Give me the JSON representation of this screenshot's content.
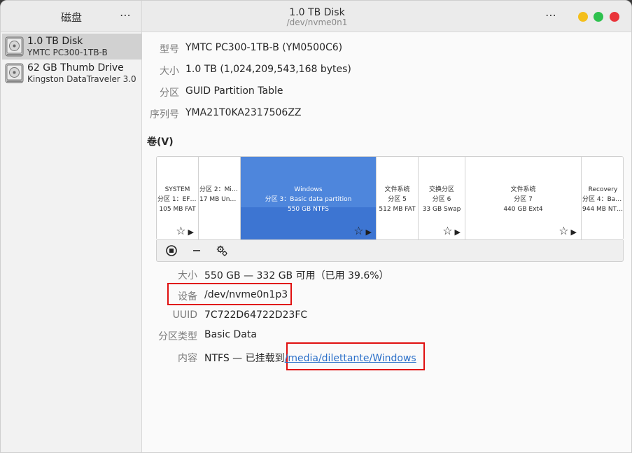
{
  "sidebar": {
    "title": "磁盘",
    "menu": "⋯",
    "drives": [
      {
        "name": "1.0 TB Disk",
        "model": "YMTC PC300-1TB-B",
        "selected": true
      },
      {
        "name": "62 GB Thumb Drive",
        "model": "Kingston DataTraveler 3.0",
        "selected": false
      }
    ]
  },
  "header": {
    "title": "1.0 TB Disk",
    "subtitle": "/dev/nvme0n1",
    "menu": "⋯"
  },
  "disk_props": {
    "model_label": "型号",
    "model_value": "YMTC PC300-1TB-B (YM0500C6)",
    "size_label": "大小",
    "size_value": "1.0 TB (1,024,209,543,168 bytes)",
    "partitioning_label": "分区",
    "partitioning_value": "GUID Partition Table",
    "serial_label": "序列号",
    "serial_value": "YMA21T0KA2317506ZZ"
  },
  "volumes": {
    "title": "卷(V)",
    "segments": [
      {
        "line1": "SYSTEM",
        "line2": "分区 1：EFI …",
        "line3": "105 MB FAT",
        "selected": false,
        "icons": true
      },
      {
        "line1": "",
        "line2": "分区 2：Mic…",
        "line3": "17 MB Unk…",
        "selected": false,
        "icons": false
      },
      {
        "line1": "Windows",
        "line2": "分区 3：Basic data partition",
        "line3": "550 GB NTFS",
        "selected": true,
        "icons": true
      },
      {
        "line1": "文件系统",
        "line2": "分区 5",
        "line3": "512 MB FAT",
        "selected": false,
        "icons": false
      },
      {
        "line1": "交换分区",
        "line2": "分区 6",
        "line3": "33 GB Swap",
        "selected": false,
        "icons": true
      },
      {
        "line1": "文件系统",
        "line2": "分区 7",
        "line3": "440 GB Ext4",
        "selected": false,
        "icons": true
      },
      {
        "line1": "Recovery",
        "line2": "分区 4：Basi…",
        "line3": "944 MB NTFS",
        "selected": false,
        "icons": false
      }
    ]
  },
  "volume_props": {
    "size_label": "大小",
    "size_value": "550 GB — 332 GB 可用（已用 39.6%）",
    "device_label": "设备",
    "device_value": "/dev/nvme0n1p3",
    "uuid_label": "UUID",
    "uuid_value": "7C722D64722D23FC",
    "type_label": "分区类型",
    "type_value": "Basic Data",
    "contents_label": "内容",
    "contents_prefix": "NTFS — 已挂载到",
    "contents_link": "/media/dilettante/Windows"
  },
  "colors": {
    "selection": "#3d75d2",
    "highlight_box": "#e01010",
    "link": "#2a6fc9",
    "close": "#e9343a",
    "minimize": "#f4bf1c",
    "maximize": "#2ec14e"
  }
}
